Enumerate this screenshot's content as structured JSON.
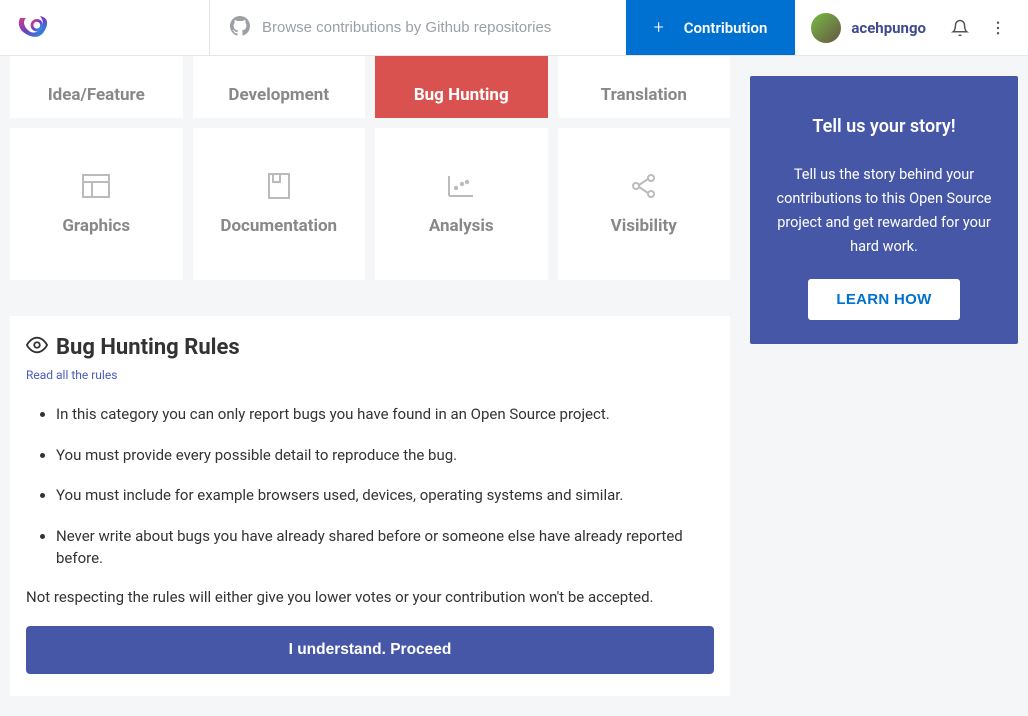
{
  "header": {
    "search_placeholder": "Browse contributions by Github repositories",
    "contribution_label": "Contribution",
    "username": "acehpungo"
  },
  "categories": {
    "row1": [
      {
        "label": "Idea/Feature",
        "active": false
      },
      {
        "label": "Development",
        "active": false
      },
      {
        "label": "Bug Hunting",
        "active": true
      },
      {
        "label": "Translation",
        "active": false
      }
    ],
    "row2": [
      {
        "label": "Graphics",
        "icon": "grid"
      },
      {
        "label": "Documentation",
        "icon": "book"
      },
      {
        "label": "Analysis",
        "icon": "chart"
      },
      {
        "label": "Visibility",
        "icon": "share"
      }
    ]
  },
  "rules": {
    "title": "Bug Hunting Rules",
    "read_all_link": "Read all the rules",
    "items": [
      "In this category you can only report bugs you have found in an Open Source project.",
      "You must provide every possible detail to reproduce the bug.",
      "You must include for example browsers used, devices, operating systems and similar.",
      "Never write about bugs you have already shared before or someone else have already reported before."
    ],
    "footer": "Not respecting the rules will either give you lower votes or your contribution won't be accepted.",
    "proceed_label": "I understand. Proceed"
  },
  "story": {
    "title": "Tell us your story!",
    "body": "Tell us the story behind your contributions to this Open Source project and get rewarded for your hard work.",
    "learn_label": "LEARN HOW"
  }
}
